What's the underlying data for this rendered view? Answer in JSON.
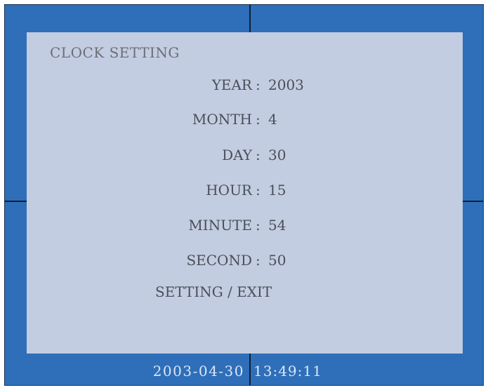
{
  "menu": {
    "title": "CLOCK SETTING",
    "fields": [
      {
        "label": "YEAR",
        "value": "2003"
      },
      {
        "label": "MONTH",
        "value": "4"
      },
      {
        "label": "DAY",
        "value": "30"
      },
      {
        "label": "HOUR",
        "value": "15"
      },
      {
        "label": "MINUTE",
        "value": "54"
      },
      {
        "label": "SECOND",
        "value": "50"
      }
    ],
    "separator": ":",
    "exit_option": "SETTING / EXIT"
  },
  "status_bar": {
    "date": "2003-04-30",
    "time": "13:49:11"
  },
  "colors": {
    "background": "#2f6fb9",
    "panel": "#c3cde2",
    "text": "#4a4f58",
    "status_text": "#dce6f6"
  }
}
